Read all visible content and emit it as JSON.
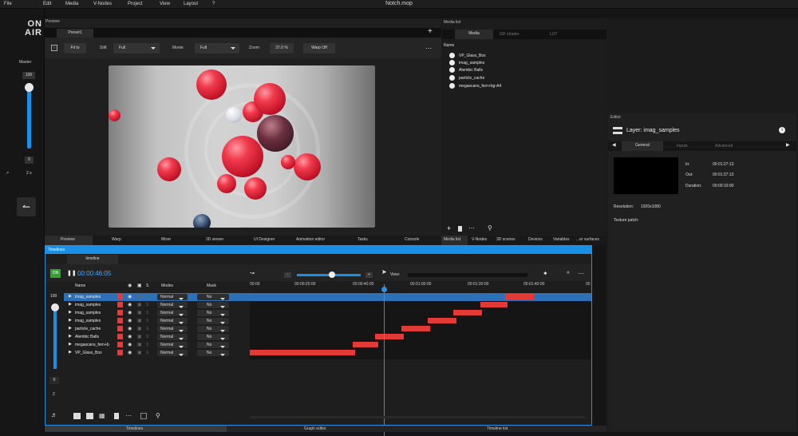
{
  "menu": {
    "items": [
      "File",
      "Edit",
      "Media",
      "V-Nodes",
      "Project",
      "View",
      "Layout",
      "?"
    ],
    "title": "Notch.mop"
  },
  "left": {
    "logo_top": "ON",
    "logo_bottom": "AIR",
    "master_label": "Master",
    "master_value": "100",
    "zero_value": "0",
    "speed_value": "2 s"
  },
  "preview": {
    "panel_title": "Preview",
    "tab": "Preset1",
    "fit_label": "Fit to",
    "still_label": "Still:",
    "still_value": "Full",
    "movie_label": "Movie:",
    "movie_value": "Full",
    "zoom_label": "Zoom:",
    "zoom_value": "37.0 %",
    "warp_label": "Warp Off"
  },
  "media_list": {
    "panel_title": "Media list",
    "tabs": [
      "Media",
      "ISF shader",
      "LUT"
    ],
    "column": "Name",
    "items": [
      "VP_Glass_Box",
      "imag_samples",
      "Alembic Balls",
      "particle_cache",
      "megascans_fern+bg-A4"
    ]
  },
  "bottom_tabs": [
    "Preview",
    "Warp",
    "Mixer",
    "3D viewer",
    "UI Designer",
    "Animation editor",
    "Tasks",
    "Console",
    "Media list",
    "V-Nodes",
    "3D scenes",
    "Devices",
    "Variables",
    "...er surfaces"
  ],
  "editor": {
    "panel_title": "Editor",
    "layer_title": "Layer: imag_samples",
    "tabs": [
      "General",
      "Inputs",
      "Advanced"
    ],
    "in_label": "In:",
    "in_value": "00:01:27:13",
    "out_label": "Out:",
    "out_value": "00:01:37:13",
    "duration_label": "Duration:",
    "duration_value": "00:00:10:00",
    "resolution_label": "Resolution:",
    "resolution_value": "1920x1080",
    "texture_label": "Texture patch:"
  },
  "timelines": {
    "panel_title": "Timelines",
    "tab": "timeline",
    "on_label": "ON",
    "timecode": "00:00:46:05",
    "col_name": "Name",
    "col_s": "S",
    "col_modes": "Modes",
    "col_mask": "Mask",
    "view_label": "View:",
    "ruler": [
      "00:00",
      "00:00:20:00",
      "00:00:40:00",
      "00:01:00:00",
      "00:01:20:00",
      "00:01:40:00",
      "00"
    ],
    "side_value_top": "100",
    "side_value_zero": "0",
    "side_value_two": "2",
    "rows": [
      {
        "name": "imag_samples",
        "mode": "Normal",
        "mask": "No"
      },
      {
        "name": "imag_samples",
        "mode": "Normal",
        "mask": "No"
      },
      {
        "name": "imag_samples",
        "mode": "Normal",
        "mask": "No"
      },
      {
        "name": "imag_samples",
        "mode": "Normal",
        "mask": "No"
      },
      {
        "name": "particle_cache",
        "mode": "Normal",
        "mask": "No"
      },
      {
        "name": "Alembic Balls",
        "mode": "Normal",
        "mask": "No"
      },
      {
        "name": "megascans_fern+b",
        "mode": "Normal",
        "mask": "No"
      },
      {
        "name": "VP_Glass_Box",
        "mode": "Normal",
        "mask": "No"
      }
    ]
  },
  "footer_tabs": [
    "Timelines",
    "Graph editor",
    "Timeline list"
  ],
  "colors": {
    "accent": "#1a8fe6",
    "clip": "#e33a36",
    "on_green": "#2fa52f"
  }
}
